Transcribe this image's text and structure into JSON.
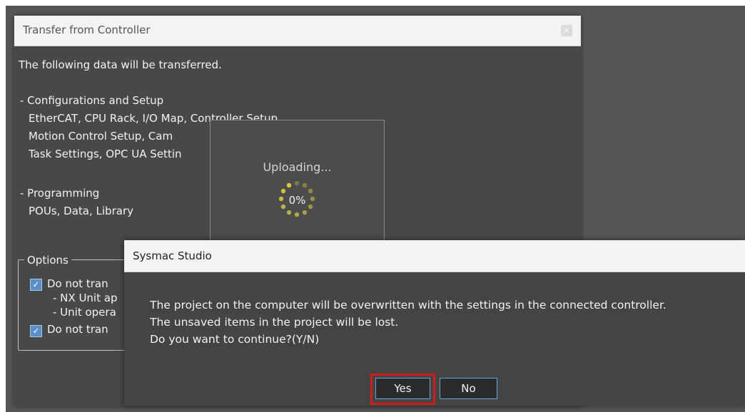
{
  "transfer_dialog": {
    "title": "Transfer from Controller",
    "close_label": "×",
    "intro": "The following data will be transferred.",
    "lines": [
      "- Configurations and Setup",
      "EtherCAT, CPU Rack, I/O Map, Controller Setup,",
      "Motion Control Setup, Cam",
      "Task Settings, OPC UA Settin",
      "- Programming",
      "POUs, Data, Library"
    ],
    "options": {
      "legend": "Options",
      "items": [
        "Do not tran",
        "- NX Unit ap",
        "- Unit opera",
        "Do not tran"
      ]
    }
  },
  "uploading": {
    "label": "Uploading...",
    "percent": "0%",
    "progress_value": 0
  },
  "sysmac_dialog": {
    "title": "Sysmac Studio",
    "message": [
      "The project on the computer will be overwritten with the settings in the connected controller.",
      "The unsaved items in the project will be lost.",
      "Do you want to continue?(Y/N)"
    ],
    "buttons": {
      "yes": "Yes",
      "no": "No"
    }
  },
  "colors": {
    "accent_border": "#6aa0d8",
    "highlight": "#d11c1c",
    "spinner": "#e0d23c"
  }
}
